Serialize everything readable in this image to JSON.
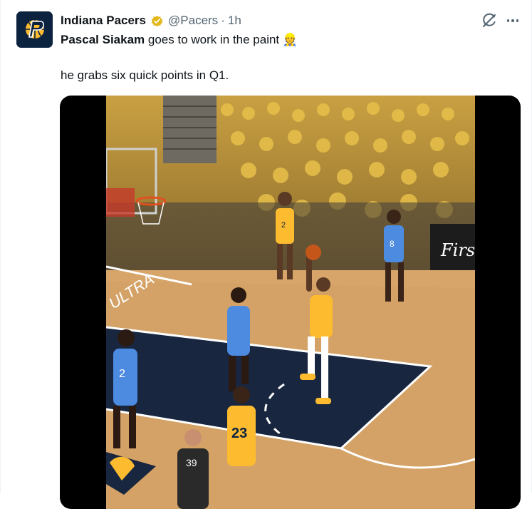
{
  "post": {
    "author_name": "Indiana Pacers",
    "handle": "@Pacers",
    "separator": "·",
    "timestamp": "1h",
    "text_mention": "Pascal Siakam",
    "text_rest": " goes to work in the paint",
    "emoji": "👷",
    "text_line2": "he grabs six quick points in Q1."
  },
  "media": {
    "type": "video",
    "banner": "ULTRA",
    "partner": "Firstbank",
    "jersey_numbers": [
      "2",
      "8",
      "2",
      "23",
      "39"
    ]
  },
  "colors": {
    "pacers_navy": "#0c2340",
    "pacers_gold": "#fdbb30",
    "verified_gold": "#e2b719",
    "secondary_text": "#536471"
  },
  "icons": {
    "verified": "verified-badge-icon",
    "grok": "grok-icon",
    "more": "more-options-icon"
  }
}
